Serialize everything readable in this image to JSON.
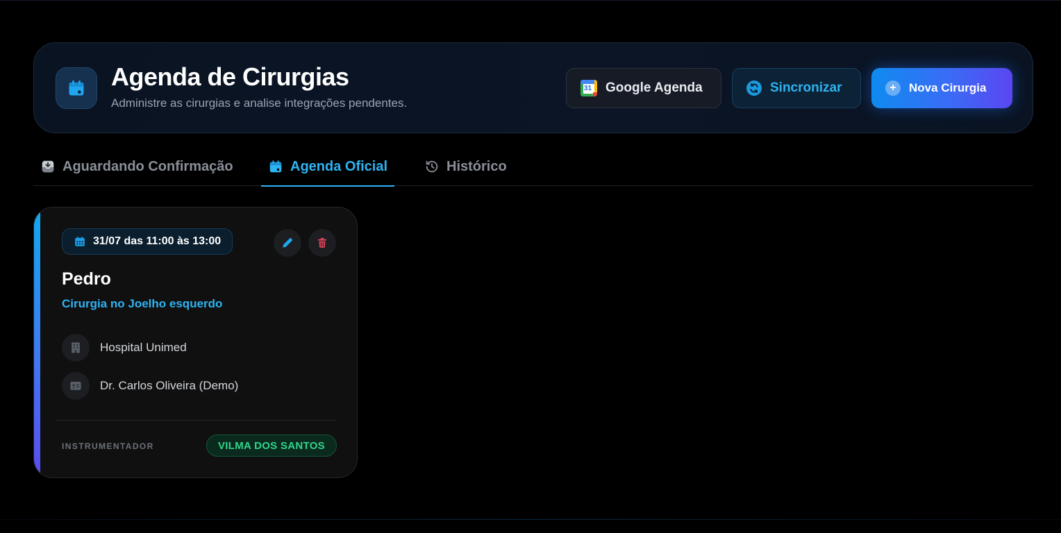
{
  "header": {
    "title": "Agenda de Cirurgias",
    "subtitle": "Administre as cirurgias e analise integrações pendentes.",
    "icon": "calendar-icon",
    "buttons": {
      "google_label": "Google Agenda",
      "google_icon_text": "31",
      "sync_label": "Sincronizar",
      "new_label": "Nova Cirurgia"
    }
  },
  "tabs": [
    {
      "label": "Aguardando Confirmação",
      "icon": "inbox-download-icon",
      "active": false
    },
    {
      "label": "Agenda Oficial",
      "icon": "calendar-icon",
      "active": true
    },
    {
      "label": "Histórico",
      "icon": "history-icon",
      "active": false
    }
  ],
  "surgery": {
    "date_range": "31/07 das 11:00 às 13:00",
    "patient": "Pedro",
    "procedure": "Cirurgia no Joelho esquerdo",
    "hospital": "Hospital Unimed",
    "doctor": "Dr. Carlos Oliveira (Demo)",
    "role_label": "INSTRUMENTADOR",
    "instrumentator": "VILMA DOS SANTOS"
  },
  "colors": {
    "accent": "#2db4f3",
    "success": "#2fd68a",
    "danger": "#e0455a",
    "primary_gradient_start": "#0f8bf0",
    "primary_gradient_end": "#5b46f2"
  }
}
